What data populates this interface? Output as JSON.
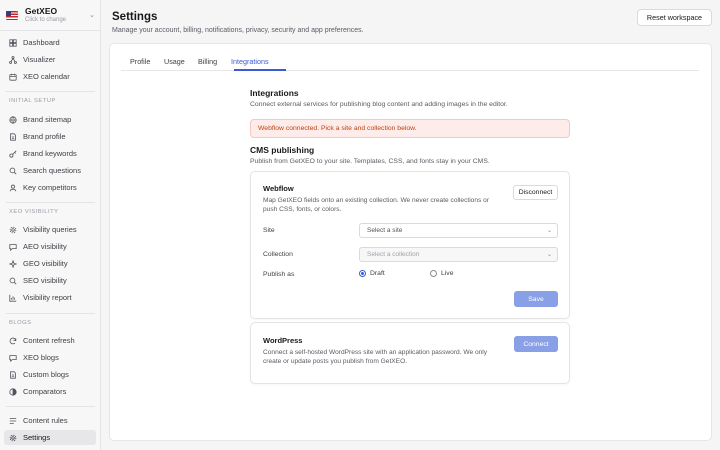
{
  "workspace": {
    "name": "GetXEO",
    "subtitle": "Click to change"
  },
  "sidebar": {
    "top": [
      {
        "label": "Dashboard",
        "icon": "dashboard-icon"
      },
      {
        "label": "Visualizer",
        "icon": "visualizer-icon"
      },
      {
        "label": "XEO calendar",
        "icon": "calendar-icon"
      }
    ],
    "sections": [
      {
        "title": "INITIAL SETUP",
        "items": [
          {
            "label": "Brand sitemap",
            "icon": "globe-icon"
          },
          {
            "label": "Brand profile",
            "icon": "document-icon"
          },
          {
            "label": "Brand keywords",
            "icon": "key-icon"
          },
          {
            "label": "Search questions",
            "icon": "search-icon"
          },
          {
            "label": "Key competitors",
            "icon": "user-icon"
          }
        ]
      },
      {
        "title": "XEO VISIBILITY",
        "items": [
          {
            "label": "Visibility queries",
            "icon": "gear-icon"
          },
          {
            "label": "AEO visibility",
            "icon": "chat-icon"
          },
          {
            "label": "GEO visibility",
            "icon": "sparkle-icon"
          },
          {
            "label": "SEO visibility",
            "icon": "search-icon"
          },
          {
            "label": "Visibility report",
            "icon": "chart-icon"
          }
        ]
      },
      {
        "title": "BLOGS",
        "items": [
          {
            "label": "Content refresh",
            "icon": "refresh-icon"
          },
          {
            "label": "XEO blogs",
            "icon": "chat-icon"
          },
          {
            "label": "Custom blogs",
            "icon": "document-icon"
          },
          {
            "label": "Comparators",
            "icon": "compare-icon"
          }
        ]
      }
    ],
    "bottom": [
      {
        "label": "Content rules",
        "icon": "rules-icon"
      },
      {
        "label": "Settings",
        "icon": "gear-icon",
        "active": true
      }
    ]
  },
  "header": {
    "title": "Settings",
    "subtitle": "Manage your account, billing, notifications, privacy, security and app preferences.",
    "reset_label": "Reset workspace"
  },
  "tabs": [
    "Profile",
    "Usage",
    "Billing",
    "Integrations"
  ],
  "active_tab": "Integrations",
  "integrations": {
    "title": "Integrations",
    "description": "Connect external services for publishing blog content and adding images in the editor.",
    "alert": "Webflow connected. Pick a site and collection below."
  },
  "cms": {
    "title": "CMS publishing",
    "description": "Publish from GetXEO to your site. Templates, CSS, and fonts stay in your CMS."
  },
  "webflow": {
    "title": "Webflow",
    "description_line1": "Map GetXEO fields onto an existing collection. We never create collections or",
    "description_line2": "push CSS, fonts, or colors.",
    "disconnect_label": "Disconnect",
    "site_label": "Site",
    "site_placeholder": "Select a site",
    "collection_label": "Collection",
    "collection_placeholder": "Select a collection",
    "publish_label": "Publish as",
    "draft_label": "Draft",
    "live_label": "Live",
    "save_label": "Save"
  },
  "wordpress": {
    "title": "WordPress",
    "description_line1": "Connect a self-hosted WordPress site with an application password. We only",
    "description_line2": "create or update posts you publish from GetXEO.",
    "connect_label": "Connect"
  },
  "colors": {
    "accent": "#3b5bd6",
    "alert_text": "#c2410c",
    "alert_bg": "#fdecea",
    "button_primary": "#8aa0e6"
  }
}
